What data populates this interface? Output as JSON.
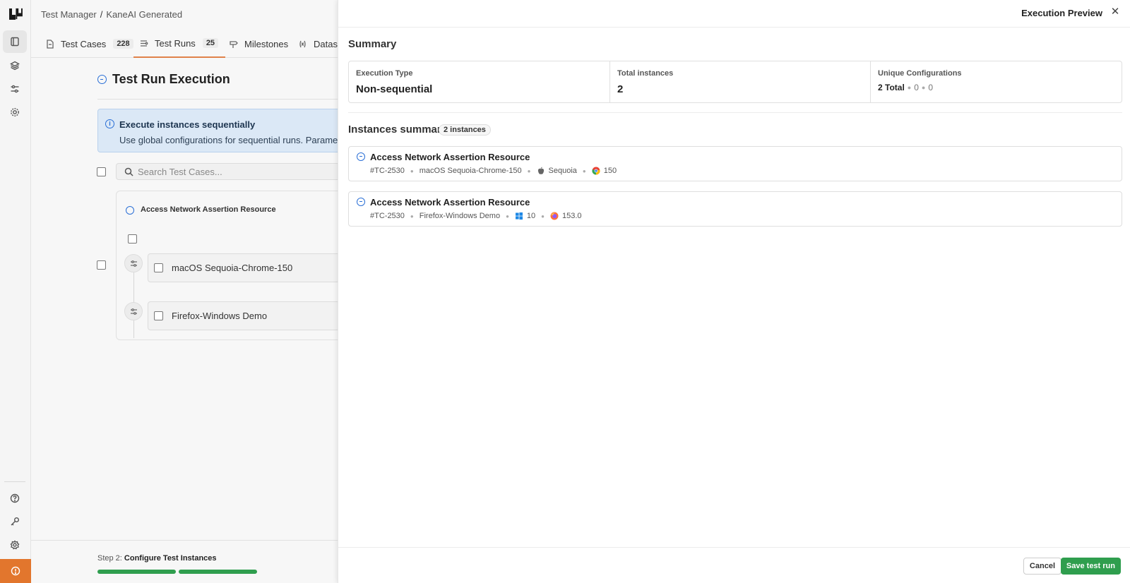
{
  "app": {
    "brand_color": "#1a1a1a",
    "accent": "#e0824a",
    "success": "#2f9e4e",
    "info": "#2a6fd6"
  },
  "breadcrumb": {
    "root": "Test Manager",
    "separator": "/",
    "current": "KaneAI Generated"
  },
  "tabs": [
    {
      "label": "Test Cases",
      "count": "228",
      "icon": "test-case-icon"
    },
    {
      "label": "Test Runs",
      "count": "25",
      "icon": "test-run-icon",
      "active": true
    },
    {
      "label": "Milestones",
      "icon": "milestone-icon"
    },
    {
      "label": "Datase",
      "icon": "dataset-icon"
    }
  ],
  "page": {
    "title": "Test Run Execution",
    "info_title": "Execute instances sequentially",
    "info_text": "Use global configurations for sequential runs. Parameterize",
    "search_placeholder": "Search Test Cases...",
    "test_case_title": "Access Network Assertion Resource",
    "configs": [
      "macOS Sequoia-Chrome-150",
      "Firefox-Windows Demo"
    ],
    "step_prefix": "Step 2:",
    "step_label": "Configure Test Instances",
    "progress_segments": 2
  },
  "drawer": {
    "title": "Execution Preview",
    "close": "✕",
    "summary_title": "Summary",
    "execution_type_label": "Execution Type",
    "execution_type_value": "Non-sequential",
    "total_instances_label": "Total instances",
    "total_instances_value": "2",
    "unique_configs_label": "Unique Configurations",
    "unique_configs_total": "2 Total",
    "unique_configs_a": "0",
    "unique_configs_b": "0",
    "instances_title": "Instances summary",
    "instances_badge": "2 instances",
    "instances": [
      {
        "title": "Access Network Assertion Resource",
        "id": "#TC-2530",
        "config": "macOS Sequoia-Chrome-150",
        "os": "Sequoia",
        "os_icon": "apple-icon",
        "browser": "150",
        "browser_icon": "chrome-icon"
      },
      {
        "title": "Access Network Assertion Resource",
        "id": "#TC-2530",
        "config": "Firefox-Windows Demo",
        "os": "10",
        "os_icon": "windows-icon",
        "browser": "153.0",
        "browser_icon": "firefox-icon"
      }
    ],
    "cancel_label": "Cancel",
    "save_label": "Save test run"
  }
}
